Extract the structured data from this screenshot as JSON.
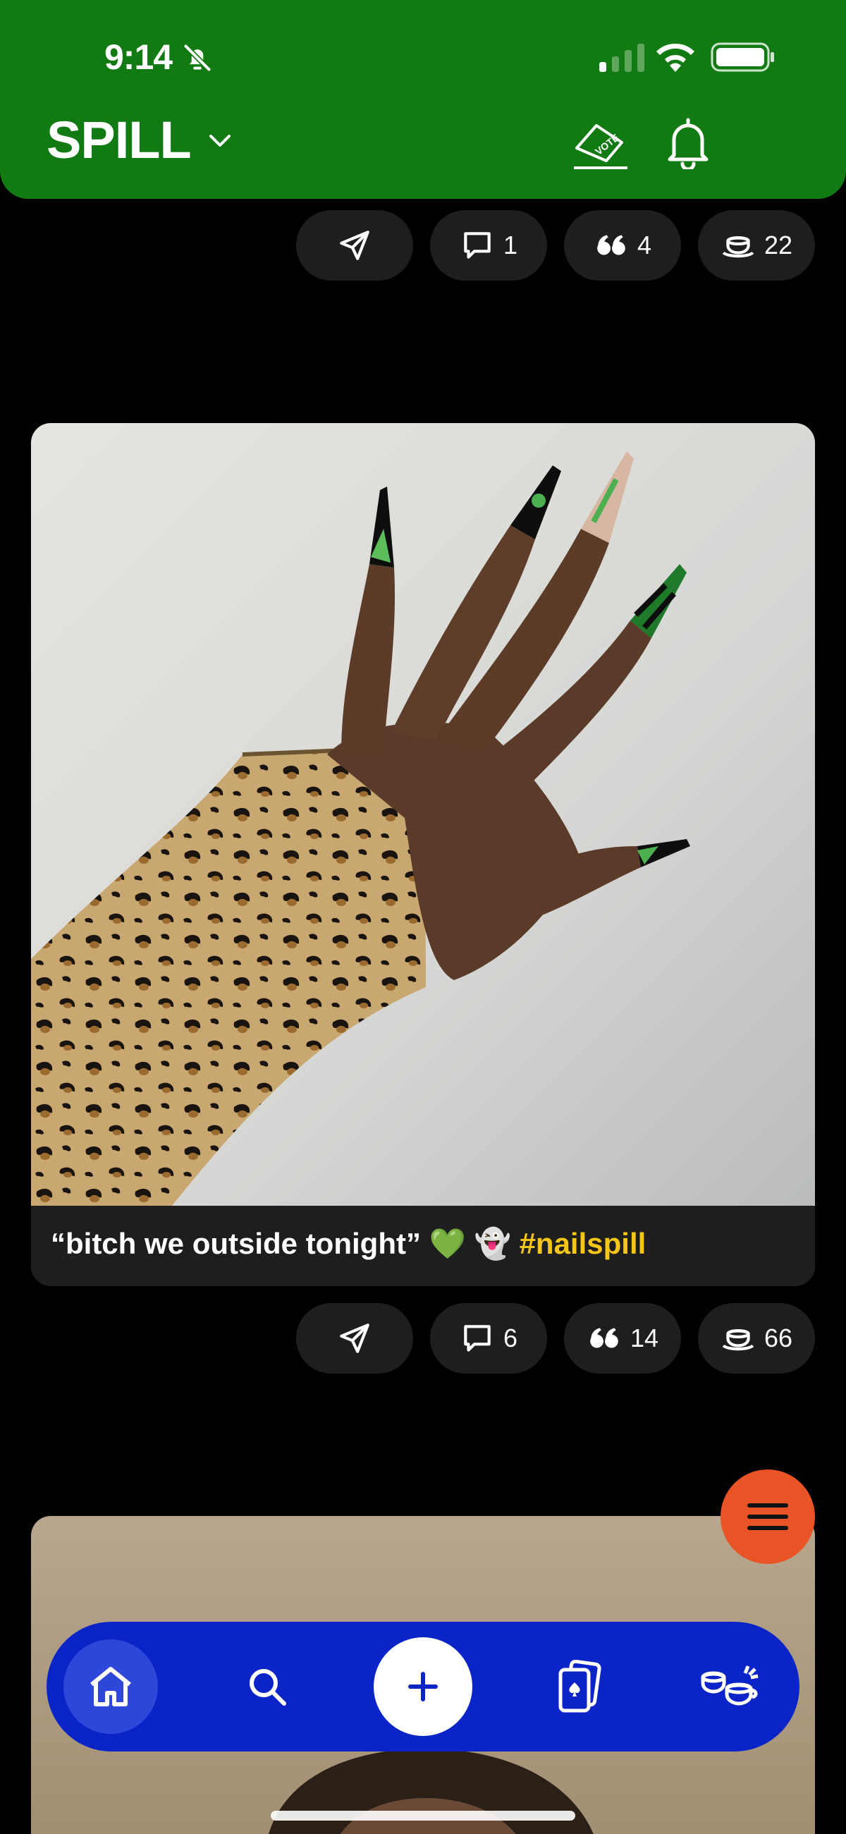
{
  "status_bar": {
    "time": "9:14"
  },
  "header": {
    "brand": "SPILL"
  },
  "posts": [
    {
      "actions": {
        "comments": "1",
        "quotes": "4",
        "tea": "22"
      }
    },
    {
      "caption": {
        "text": "“bitch we outside tonight” 💚 👻 ",
        "hashtag": "#nailspill"
      },
      "actions": {
        "comments": "6",
        "quotes": "14",
        "tea": "66"
      }
    }
  ],
  "colors": {
    "header_green": "#127A12",
    "hashtag_yellow": "#F5C518",
    "nav_blue": "#0A24C8",
    "menu_orange": "#E95426",
    "pill_bg": "#1E1E1E"
  },
  "icons": [
    "bell-slash-icon",
    "signal-icon",
    "wifi-icon",
    "battery-icon",
    "chevron-down-icon",
    "vote-icon",
    "bell-icon",
    "send-icon",
    "comment-icon",
    "quote-icon",
    "tea-cup-icon",
    "menu-icon",
    "home-icon",
    "search-icon",
    "plus-icon",
    "cards-icon",
    "teacups-icon"
  ]
}
